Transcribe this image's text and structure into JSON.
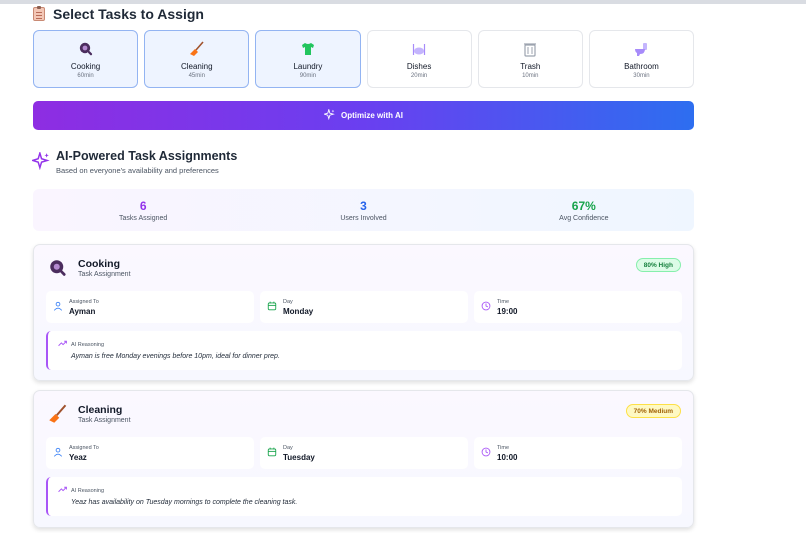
{
  "select_section": {
    "title": "Select Tasks to Assign",
    "icon": "clipboard-icon"
  },
  "tasks": [
    {
      "name": "Cooking",
      "duration": "60min",
      "selected": true,
      "icon": "frying-pan-icon"
    },
    {
      "name": "Cleaning",
      "duration": "45min",
      "selected": true,
      "icon": "broom-icon"
    },
    {
      "name": "Laundry",
      "duration": "90min",
      "selected": true,
      "icon": "shirt-icon"
    },
    {
      "name": "Dishes",
      "duration": "20min",
      "selected": false,
      "icon": "dishes-icon"
    },
    {
      "name": "Trash",
      "duration": "10min",
      "selected": false,
      "icon": "trash-icon"
    },
    {
      "name": "Bathroom",
      "duration": "30min",
      "selected": false,
      "icon": "toilet-icon"
    }
  ],
  "optimize_button": {
    "label": "Optimize with AI",
    "icon": "sparkles-icon"
  },
  "ai_section": {
    "title": "AI-Powered Task Assignments",
    "subtitle": "Based on everyone's availability and preferences",
    "icon": "sparkles-icon"
  },
  "stats": [
    {
      "value": "6",
      "label": "Tasks Assigned",
      "color": "#9333ea"
    },
    {
      "value": "3",
      "label": "Users Involved",
      "color": "#2563eb"
    },
    {
      "value": "67%",
      "label": "Avg Confidence",
      "color": "#16a34a"
    }
  ],
  "assignments": [
    {
      "task": "Cooking",
      "subtitle": "Task Assignment",
      "icon": "frying-pan-icon",
      "confidence": "80% High",
      "level": "high",
      "assigned_label": "Assigned To",
      "assigned_to": "Ayman",
      "day_label": "Day",
      "day": "Monday",
      "time_label": "Time",
      "time": "19:00",
      "reasoning_label": "AI Reasoning",
      "reasoning": "Ayman is free Monday evenings before 10pm, ideal for dinner prep."
    },
    {
      "task": "Cleaning",
      "subtitle": "Task Assignment",
      "icon": "broom-icon",
      "confidence": "70% Medium",
      "level": "medium",
      "assigned_label": "Assigned To",
      "assigned_to": "Yeaz",
      "day_label": "Day",
      "day": "Tuesday",
      "time_label": "Time",
      "time": "10:00",
      "reasoning_label": "AI Reasoning",
      "reasoning": "Yeaz has availability on Tuesday mornings to complete the cleaning task."
    }
  ],
  "colors": {
    "accent_purple": "#9333ea",
    "accent_blue": "#2563eb",
    "success_green": "#16a34a"
  }
}
